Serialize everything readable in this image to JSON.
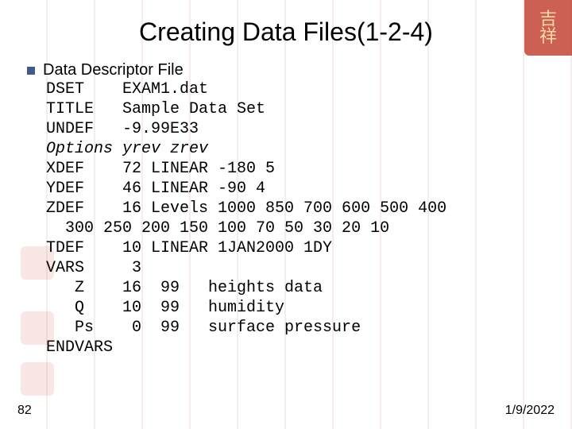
{
  "title": "Creating Data Files(1-2-4)",
  "bullet_label": "Data Descriptor File",
  "lines": {
    "l01": "DSET    EXAM1.dat",
    "l02": "TITLE   Sample Data Set",
    "l03": "UNDEF   -9.99E33",
    "l04": "Options yrev zrev",
    "l05": "XDEF    72 LINEAR -180 5",
    "l06": "YDEF    46 LINEAR -90 4",
    "l07": "ZDEF    16 Levels 1000 850 700 600 500 400",
    "l08": "  300 250 200 150 100 70 50 30 20 10",
    "l09": "TDEF    10 LINEAR 1JAN2000 1DY",
    "l10": "VARS     3",
    "l11": "   Z    16  99   heights data",
    "l12": "   Q    10  99   humidity",
    "l13": "   Ps    0  99   surface pressure",
    "l14": "ENDVARS"
  },
  "footer": {
    "page": "82",
    "date": "1/9/2022"
  },
  "decor": {
    "corner_top": "吉",
    "corner_bottom": "祥"
  },
  "chart_data": {
    "type": "table",
    "title": "Data Descriptor File",
    "entries": [
      {
        "key": "DSET",
        "value": "EXAM1.dat"
      },
      {
        "key": "TITLE",
        "value": "Sample Data Set"
      },
      {
        "key": "UNDEF",
        "value": "-9.99E33"
      },
      {
        "key": "Options",
        "value": "yrev zrev"
      },
      {
        "key": "XDEF",
        "value": "72 LINEAR -180 5"
      },
      {
        "key": "YDEF",
        "value": "46 LINEAR -90 4"
      },
      {
        "key": "ZDEF",
        "value": "16 Levels 1000 850 700 600 500 400 300 250 200 150 100 70 50 30 20 10"
      },
      {
        "key": "TDEF",
        "value": "10 LINEAR 1JAN2000 1DY"
      },
      {
        "key": "VARS",
        "value": "3"
      },
      {
        "key": "Z",
        "value": "16 99 heights data"
      },
      {
        "key": "Q",
        "value": "10 99 humidity"
      },
      {
        "key": "Ps",
        "value": "0 99 surface pressure"
      },
      {
        "key": "ENDVARS",
        "value": ""
      }
    ]
  }
}
